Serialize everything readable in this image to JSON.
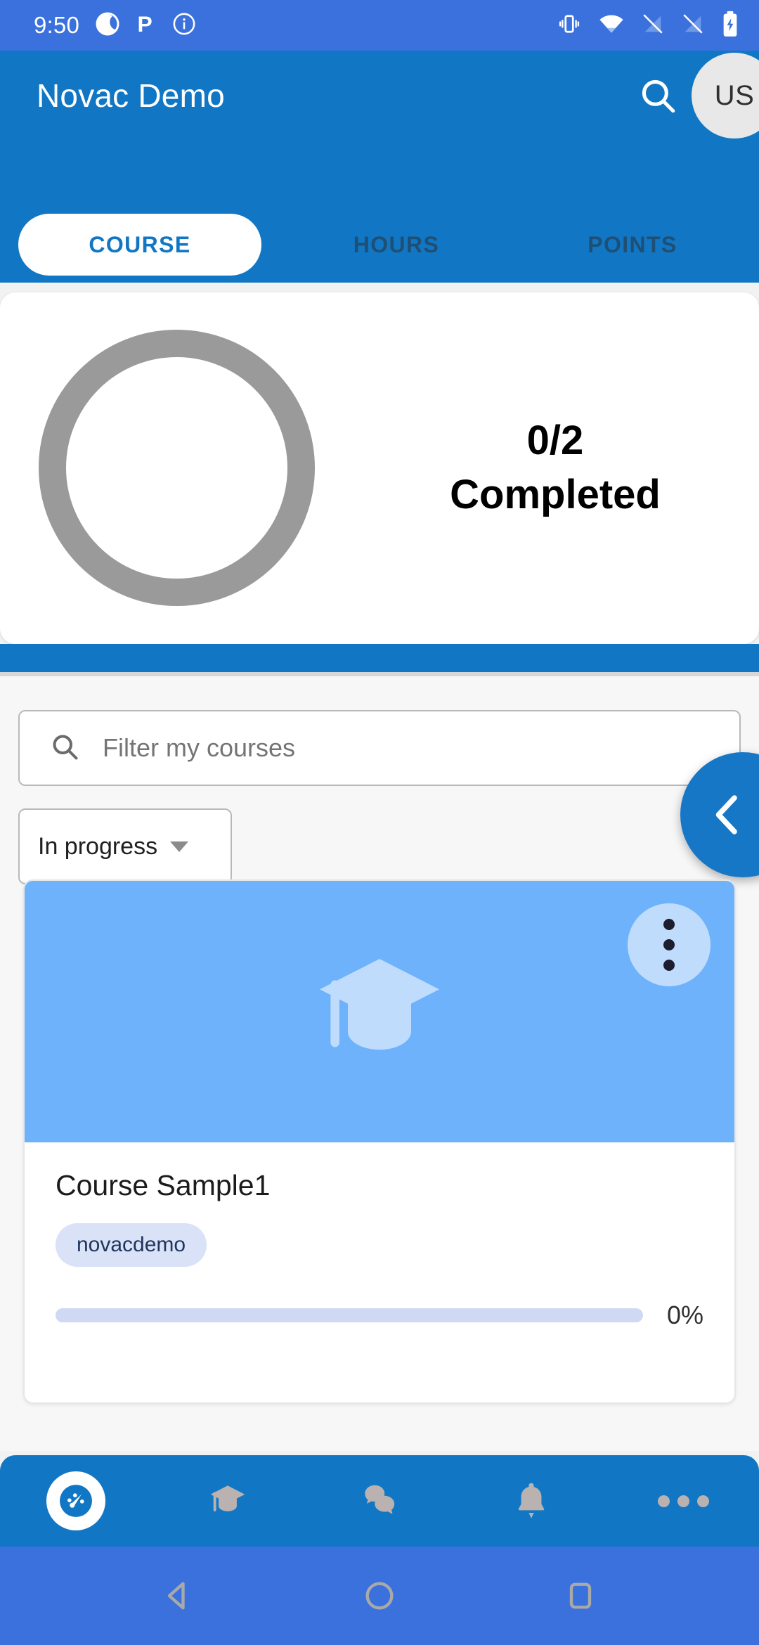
{
  "status_bar": {
    "time": "9:50",
    "left_icons": [
      "camera-app-icon",
      "p-app-icon",
      "info-icon"
    ],
    "right_icons": [
      "vibrate-icon",
      "wifi-icon",
      "signal-off-icon",
      "signal-off-2-icon",
      "battery-charging-icon"
    ],
    "background_color": "#3b71dd"
  },
  "app_bar": {
    "title": "Novac Demo",
    "search_icon": "search-icon",
    "avatar_initials": "US",
    "background_color": "#1177c4"
  },
  "tabs": [
    {
      "label": "COURSE",
      "active": true
    },
    {
      "label": "HOURS",
      "active": false
    },
    {
      "label": "POINTS",
      "active": false
    }
  ],
  "progress_card": {
    "count_label": "0/2",
    "status_label": "Completed",
    "completed": 0,
    "total": 2,
    "ring_color": "#9a9a9a"
  },
  "filter": {
    "search_icon": "search-icon",
    "placeholder": "Filter my courses",
    "value": ""
  },
  "dropdown": {
    "selected": "In progress",
    "caret_icon": "chevron-down-icon"
  },
  "fab": {
    "icon": "chevron-left-icon",
    "color": "#1577c6"
  },
  "course_cards": [
    {
      "cover_icon": "graduation-cap-icon",
      "cover_color": "#6fb2fc",
      "menu_icon": "more-vertical-icon",
      "title": "Course Sample1",
      "tag": "novacdemo",
      "progress_percent": 0,
      "progress_label": "0%"
    }
  ],
  "bottom_nav": [
    {
      "icon": "dashboard-icon",
      "active": true
    },
    {
      "icon": "graduation-cap-icon",
      "active": false
    },
    {
      "icon": "chat-bubbles-icon",
      "active": false
    },
    {
      "icon": "bell-icon",
      "active": false
    },
    {
      "icon": "more-horizontal-icon",
      "active": false
    }
  ],
  "android_nav": [
    {
      "icon": "back-triangle-icon"
    },
    {
      "icon": "home-circle-icon"
    },
    {
      "icon": "recents-square-icon"
    }
  ]
}
